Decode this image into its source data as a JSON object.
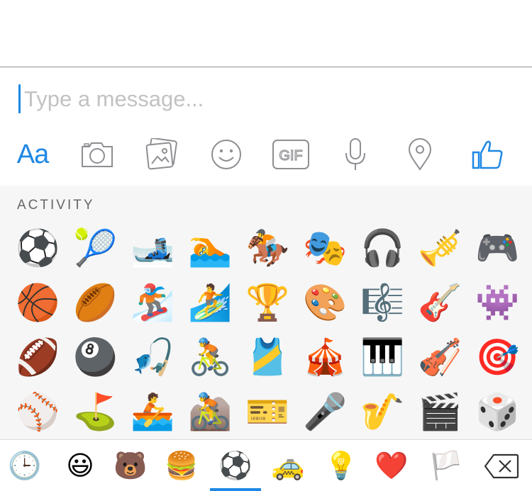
{
  "composer": {
    "placeholder": "Type a message...",
    "text_button": "Aa"
  },
  "toolbar_icons": [
    "text-icon",
    "camera-icon",
    "gallery-icon",
    "sticker-icon",
    "gif-icon",
    "microphone-icon",
    "location-icon",
    "thumbs-up-icon"
  ],
  "gif_label": "GIF",
  "picker": {
    "section_title": "ACTIVITY",
    "rows": [
      [
        "⚽",
        "🎾",
        "🎿",
        "🏊",
        "🏇",
        "🎭",
        "🎧",
        "🎺",
        "🎮"
      ],
      [
        "🏀",
        "🏉",
        "🏂",
        "🏄",
        "🏆",
        "🎨",
        "🎼",
        "🎸",
        "👾"
      ],
      [
        "🏈",
        "🎱",
        "🎣",
        "🚴",
        "🎽",
        "🎪",
        "🎹",
        "🎻",
        "🎯"
      ],
      [
        "⚾",
        "⛳",
        "🚣",
        "🚵",
        "🎫",
        "🎤",
        "🎷",
        "🎬",
        "🎲"
      ]
    ]
  },
  "categories": [
    {
      "name": "recent",
      "glyph": "🕒"
    },
    {
      "name": "smileys",
      "glyph": "😃"
    },
    {
      "name": "animals",
      "glyph": "🐻"
    },
    {
      "name": "food",
      "glyph": "🍔"
    },
    {
      "name": "activity",
      "glyph": "⚽",
      "selected": true
    },
    {
      "name": "travel",
      "glyph": "🚕"
    },
    {
      "name": "objects",
      "glyph": "💡"
    },
    {
      "name": "symbols",
      "glyph": "❤️"
    },
    {
      "name": "flags",
      "glyph": "🏳️"
    }
  ],
  "colors": {
    "accent": "#1e88e5",
    "icon_gray": "#8e8e93",
    "panel_bg": "#f6f6f7"
  }
}
